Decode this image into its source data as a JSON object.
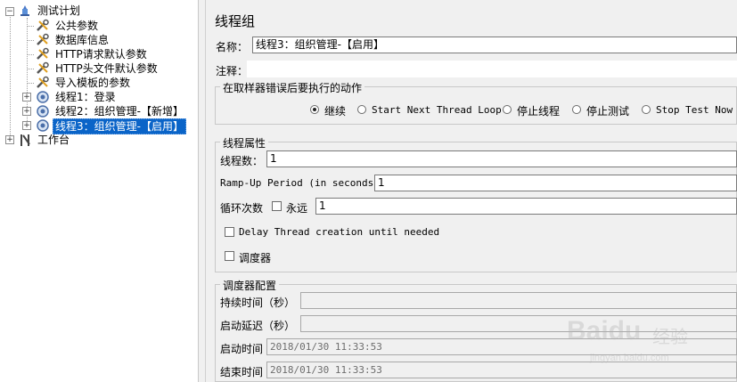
{
  "tree": {
    "root": {
      "label": "测试计划",
      "icon": "test-plan-icon",
      "expanded": true
    },
    "items": [
      {
        "label": "公共参数",
        "icon": "config-wrench-icon"
      },
      {
        "label": "数据库信息",
        "icon": "config-wrench-icon"
      },
      {
        "label": "HTTP请求默认参数",
        "icon": "config-wrench-icon"
      },
      {
        "label": "HTTP头文件默认参数",
        "icon": "config-wrench-icon"
      },
      {
        "label": "导入模板的参数",
        "icon": "config-wrench-icon"
      },
      {
        "label": "线程1：登录",
        "icon": "thread-group-icon",
        "expander": "+"
      },
      {
        "label": "线程2：组织管理-【新增】",
        "icon": "thread-group-icon",
        "expander": "+"
      },
      {
        "label": "线程3：组织管理-【启用】",
        "icon": "thread-group-icon",
        "expander": "+",
        "selected": true
      }
    ],
    "workbench": {
      "label": "工作台",
      "icon": "workbench-icon",
      "expander": "+"
    }
  },
  "panel": {
    "title": "线程组",
    "name_label": "名称：",
    "name_value": "线程3：组织管理-【启用】",
    "comment_label": "注释：",
    "comment_value": "",
    "error_action": {
      "title": "在取样器错误后要执行的动作",
      "options": [
        "继续",
        "Start Next Thread Loop",
        "停止线程",
        "停止测试",
        "Stop Test Now"
      ],
      "selected": "继续"
    },
    "thread_props": {
      "title": "线程属性",
      "threads_label": "线程数：",
      "threads_value": "1",
      "rampup_label": "Ramp-Up Period (in seconds):",
      "rampup_value": "1",
      "loop_label": "循环次数",
      "forever_label": "永远",
      "forever_checked": false,
      "loop_value": "1",
      "delay_label": "Delay Thread creation until needed",
      "delay_checked": false,
      "scheduler_label": "调度器",
      "scheduler_checked": false
    },
    "scheduler": {
      "title": "调度器配置",
      "duration_label": "持续时间（秒）",
      "duration_value": "",
      "delay_label": "启动延迟（秒）",
      "delay_value": "",
      "start_label": "启动时间",
      "start_value": "2018/01/30 11:33:53",
      "end_label": "结束时间",
      "end_value": "2018/01/30 11:33:53"
    }
  },
  "watermark": {
    "brand": "Baidu",
    "cn": "经验",
    "url": "jingyan.baidu.com"
  },
  "colors": {
    "selection": "#0a64c8",
    "panel_bg": "#f0f0f0"
  }
}
